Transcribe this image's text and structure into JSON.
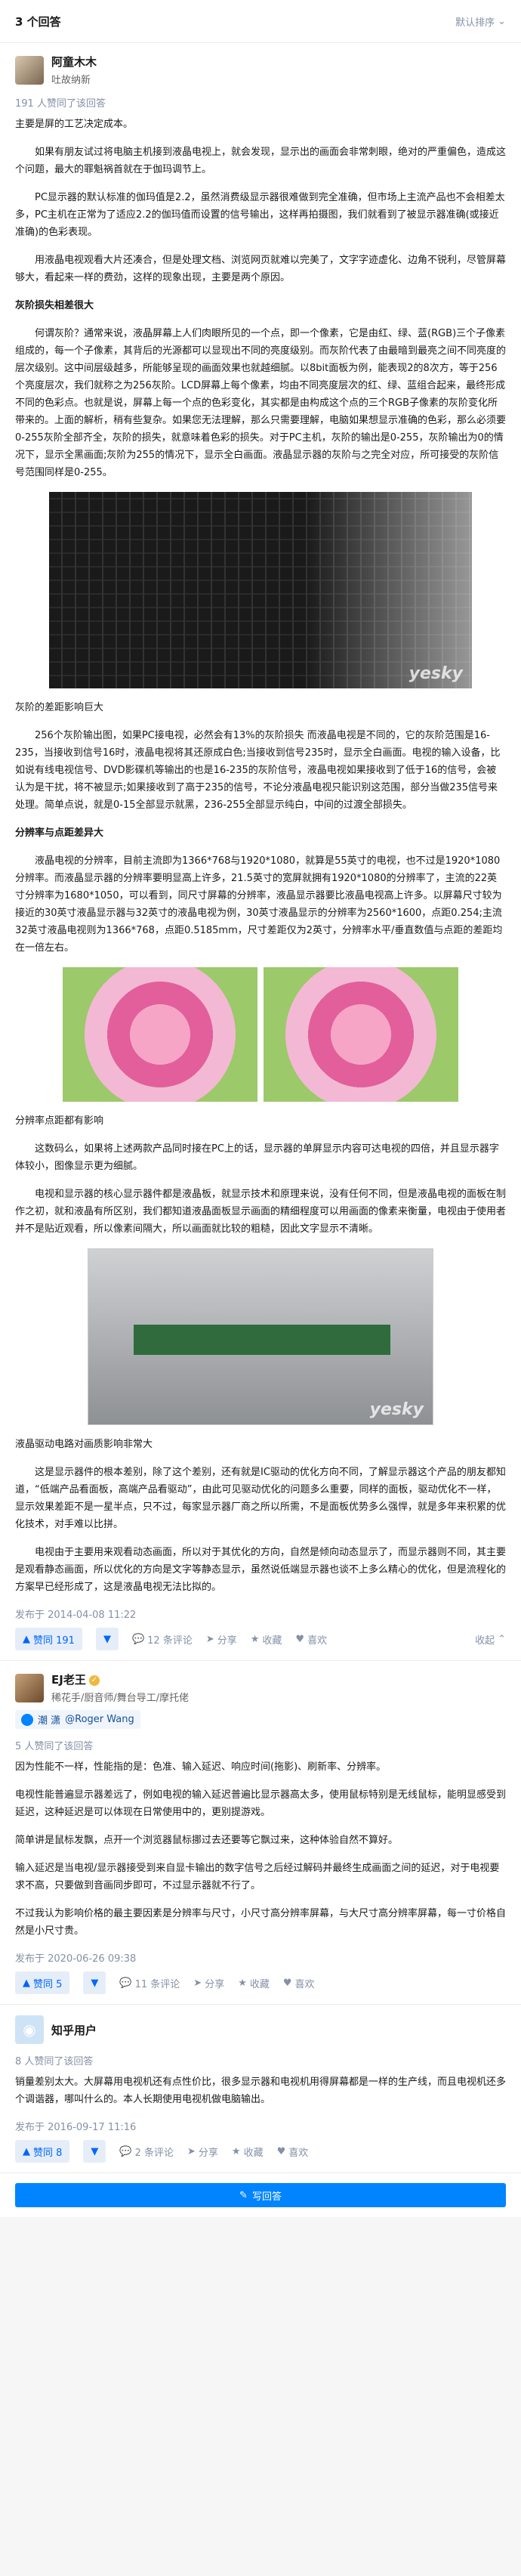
{
  "header": {
    "count": "3 个回答",
    "sort": "默认排序"
  },
  "answers": [
    {
      "author": "阿童木木",
      "headline": "吐故纳新",
      "votes": "191 人赞同了该回答",
      "content": [
        {
          "t": "主要是屏的工艺决定成本。",
          "cls": "noindent"
        },
        {
          "t": "如果有朋友试过将电脑主机接到液晶电视上，就会发现，显示出的画面会非常刺眼，绝对的严重偏色，造成这个问题，最大的罪魁祸首就在于伽玛调节上。"
        },
        {
          "t": "PC显示器的默认标准的伽玛值是2.2，虽然消费级显示器很难做到完全准确，但市场上主流产品也不会相差太多，PC主机在正常为了适应2.2的伽玛值而设置的信号输出，这样再拍摄图，我们就看到了被显示器准确(或接近准确)的色彩表现。"
        },
        {
          "t": "用液晶电视观看大片还凑合，但是处理文档、浏览网页就难以完美了，文字字迹虚化、边角不锐利，尽管屏幕够大，看起来一样的费劲，这样的现象出现，主要是两个原因。"
        },
        {
          "t": "灰阶损失相差很大",
          "cls": "h"
        },
        {
          "t": "何谓灰阶？通常来说，液晶屏幕上人们肉眼所见的一个点，即一个像素，它是由红、绿、蓝(RGB)三个子像素组成的，每一个子像素，其背后的光源都可以显现出不同的亮度级别。而灰阶代表了由最暗到最亮之间不同亮度的层次级别。这中间层级越多，所能够呈现的画面效果也就越细腻。以8bit面板为例，能表现2的8次方，等于256个亮度层次，我们就称之为256灰阶。LCD屏幕上每个像素，均由不同亮度层次的红、绿、蓝组合起来，最终形成不同的色彩点。也就是说，屏幕上每一个点的色彩变化，其实都是由构成这个点的三个RGB子像素的灰阶变化所带来的。上面的解析，稍有些复杂。如果您无法理解，那么只需要理解，电脑如果想显示准确的色彩，那么必须要0-255灰阶全部齐全，灰阶的损失，就意味着色彩的损失。对于PC主机，灰阶的输出是0-255，灰阶输出为0的情况下，显示全黑画面;灰阶为255的情况下，显示全白画面。液晶显示器的灰阶与之完全对应，所可接受的灰阶信号范围同样是0-255。"
        },
        {
          "t": "灰阶的差距影响巨大",
          "cls": "cap"
        },
        {
          "t": "256个灰阶输出图，如果PC接电视，必然会有13%的灰阶损失 而液晶电视是不同的，它的灰阶范围是16-235，当接收到信号16时，液晶电视将其还原成白色;当接收到信号235时，显示全白画面。电视的输入设备，比如说有线电视信号、DVD影碟机等输出的也是16-235的灰阶信号，液晶电视如果接收到了低于16的信号，会被认为是干扰，将不被显示;如果接收到了高于235的信号，不论分液晶电视只能识别这范围，部分当做235信号来处理。简单点说，就是0-15全部显示就黑，236-255全部显示纯白，中间的过渡全部损失。"
        },
        {
          "t": "分辨率与点距差异大",
          "cls": "h"
        },
        {
          "t": "液晶电视的分辨率，目前主流即为1366*768与1920*1080，就算是55英寸的电视，也不过是1920*1080分辨率。而液晶显示器的分辨率要明显高上许多，21.5英寸的宽屏就拥有1920*1080的分辨率了，主流的22英寸分辨率为1680*1050，可以看到，同尺寸屏幕的分辨率，液晶显示器要比液晶电视高上许多。以屏幕尺寸较为接近的30英寸液晶显示器与32英寸的液晶电视为例，30英寸液晶显示的分辨率为2560*1600，点距0.254;主流32英寸液晶电视则为1366*768，点距0.5185mm，尺寸差距仅为2英寸，分辨率水平/垂直数值与点距的差距均在一倍左右。"
        },
        {
          "t": "分辨率点距都有影响",
          "cls": "cap"
        },
        {
          "t": "这数码么，如果将上述两款产品同时接在PC上的话，显示器的单屏显示内容可达电视的四倍，并且显示器字体较小，图像显示更为细腻。"
        },
        {
          "t": "电视和显示器的核心显示器件都是液晶板，就显示技术和原理来说，没有任何不同，但是液晶电视的面板在制作之初，就和液晶有所区别，我们都知道液晶面板显示画面的精细程度可以用画面的像素来衡量，电视由于使用者并不是贴近观看，所以像素间隔大，所以画面就比较的粗糙，因此文字显示不清晰。"
        },
        {
          "t": "液晶驱动电路对画质影响非常大",
          "cls": "cap"
        },
        {
          "t": "这是显示器件的根本差别，除了这个差别，还有就是IC驱动的优化方向不同，了解显示器这个产品的朋友都知道，“低端产品看面板，高端产品看驱动”，由此可见驱动优化的问题多么重要，同样的面板，驱动优化不一样，显示效果差距不是一星半点，只不过，每家显示器厂商之所以所需，不是面板优势多么强悍，就是多年来积累的优化技术，对手难以比拼。"
        },
        {
          "t": "电视由于主要用来观看动态画面，所以对于其优化的方向，自然是倾向动态显示了，而显示器则不同，其主要是观看静态画面，所以优化的方向是文字等静态显示，虽然说低端显示器也谈不上多么精心的优化，但是流程化的方案早已经形成了，这是液晶电视无法比拟的。"
        }
      ],
      "figures": {
        "wm": "yesky"
      },
      "time": "发布于 2014-04-08 11:22",
      "actions": {
        "vote": "赞同 191",
        "comments": "12 条评论",
        "share": "分享",
        "fav": "收藏",
        "like": "喜欢",
        "collapse": "收起"
      }
    },
    {
      "author": "EJ老王",
      "headline": "稀花手/厨音师/舞台导工/摩托佬",
      "follow": "@Roger Wang",
      "follow_prefix": "潮 潇",
      "votes": "5 人赞同了该回答",
      "content": [
        "因为性能不一样，性能指的是：色准、输入延迟、响应时间(拖影)、刷新率、分辨率。",
        "电视性能普遍显示器差远了，例如电视的输入延迟普遍比显示器高太多，使用鼠标特别是无线鼠标，能明显感受到延迟，这种延迟是可以体现在日常使用中的，更别提游戏。",
        "简单讲是鼠标发飘，点开一个浏览器鼠标挪过去还要等它飘过来，这种体验自然不算好。",
        "输入延迟是当电视/显示器接受到来自显卡输出的数字信号之后经过解码并最终生成画面之间的延迟，对于电视要求不高，只要做到音画同步即可，不过显示器就不行了。",
        "不过我认为影响价格的最主要因素是分辨率与尺寸，小尺寸高分辨率屏幕，与大尺寸高分辨率屏幕，每一寸价格自然是小尺寸贵。"
      ],
      "time": "发布于 2020-06-26 09:38",
      "actions": {
        "vote": "赞同 5",
        "comments": "11 条评论",
        "share": "分享",
        "fav": "收藏",
        "like": "喜欢"
      }
    },
    {
      "author": "知乎用户",
      "votes": "8 人赞同了该回答",
      "content": [
        "销量差别太大。大屏幕用电视机还有点性价比，很多显示器和电视机用得屏幕都是一样的生产线，而且电视机还多个调谐器，哪叫什么的。本人长期使用电视机做电脑输出。"
      ],
      "time": "发布于 2016-09-17 11:16",
      "actions": {
        "vote": "赞同 8",
        "comments": "2 条评论",
        "share": "分享",
        "fav": "收藏",
        "like": "喜欢"
      }
    }
  ],
  "footer": {
    "button": "写回答"
  }
}
